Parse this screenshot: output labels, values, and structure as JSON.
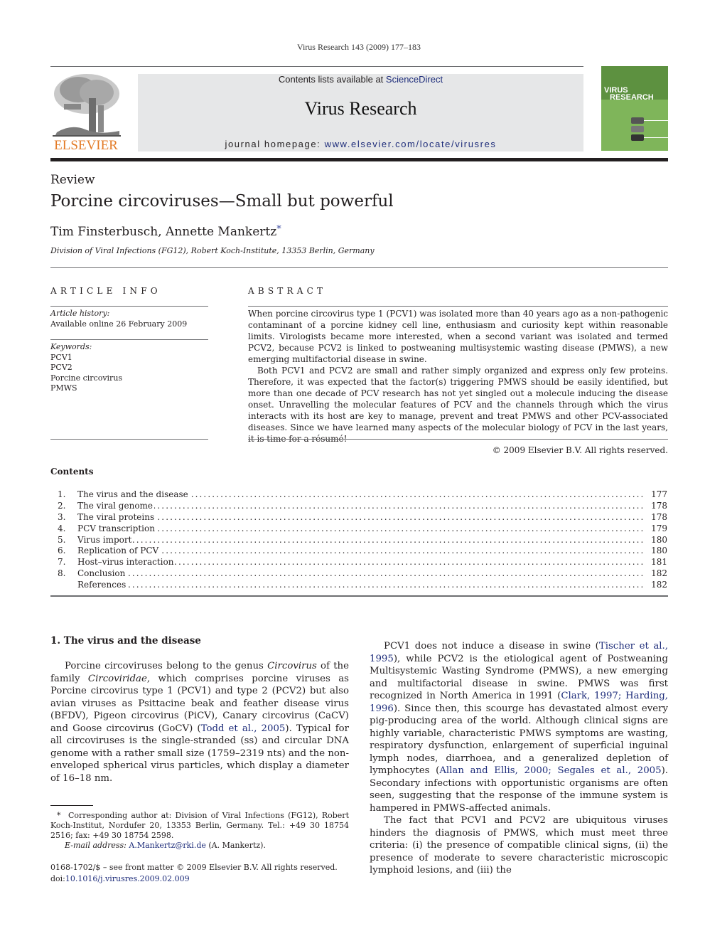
{
  "running_head": "Virus Research 143 (2009) 177–183",
  "masthead": {
    "contents_prefix": "Contents lists available at ",
    "contents_link": "ScienceDirect",
    "journal_title": "Virus Research",
    "homepage_prefix": "journal homepage: ",
    "homepage_link": "www.elsevier.com/locate/virusres",
    "publisher_logo_text": "ELSEVIER",
    "cover_title_line1": "VIRUS",
    "cover_title_line2": "RESEARCH",
    "colors": {
      "band": "#e6e7e8",
      "link": "#1d2c7a",
      "elsevier_orange": "#e37b27",
      "cover_green": "#7fb55a"
    }
  },
  "article": {
    "type": "Review",
    "title": "Porcine circoviruses—Small but powerful",
    "authors": "Tim Finsterbusch, Annette Mankertz",
    "corresponding_marker": "*",
    "affiliation": "Division of Viral Infections (FG12), Robert Koch-Institute, 13353 Berlin, Germany"
  },
  "article_info": {
    "heading": "ARTICLE INFO",
    "history_label": "Article history:",
    "history_value": "Available online 26 February 2009",
    "keywords_label": "Keywords:",
    "keywords": [
      "PCV1",
      "PCV2",
      "Porcine circovirus",
      "PMWS"
    ]
  },
  "abstract": {
    "heading": "ABSTRACT",
    "paragraphs": [
      "When porcine circovirus type 1 (PCV1) was isolated more than 40 years ago as a non-pathogenic contaminant of a porcine kidney cell line, enthusiasm and curiosity kept within reasonable limits. Virologists became more interested, when a second variant was isolated and termed PCV2, because PCV2 is linked to postweaning multisystemic wasting disease (PMWS), a new emerging multifactorial disease in swine.",
      "Both PCV1 and PCV2 are small and rather simply organized and express only few proteins. Therefore, it was expected that the factor(s) triggering PMWS should be easily identified, but more than one decade of PCV research has not yet singled out a molecule inducing the disease onset. Unravelling the molecular features of PCV and the channels through which the virus interacts with its host are key to manage, prevent and treat PMWS and other PCV-associated diseases. Since we have learned many aspects of the molecular biology of PCV in the last years, it is time for a résumé!"
    ],
    "copyright": "© 2009 Elsevier B.V. All rights reserved."
  },
  "contents": {
    "heading": "Contents",
    "items": [
      {
        "num": "1.",
        "label": "The virus and the disease",
        "page": "177"
      },
      {
        "num": "2.",
        "label": "The viral genome",
        "page": "178"
      },
      {
        "num": "3.",
        "label": "The viral proteins",
        "page": "178"
      },
      {
        "num": "4.",
        "label": "PCV transcription",
        "page": "179"
      },
      {
        "num": "5.",
        "label": "Virus import",
        "page": "180"
      },
      {
        "num": "6.",
        "label": "Replication of PCV",
        "page": "180"
      },
      {
        "num": "7.",
        "label": "Host–virus interaction",
        "page": "181"
      },
      {
        "num": "8.",
        "label": "Conclusion",
        "page": "182"
      },
      {
        "num": "",
        "label": "References",
        "page": "182"
      }
    ]
  },
  "section1": {
    "heading": "1.  The virus and the disease",
    "left_p1": {
      "t1": "Porcine circoviruses belong to the genus ",
      "i1": "Circovirus",
      "t2": " of the family ",
      "i2": "Circoviridae",
      "t3": ", which comprises porcine viruses as Porcine circovirus type 1 (PCV1) and type 2 (PCV2) but also avian viruses as Psittacine beak and feather disease virus (BFDV), Pigeon circovirus (PiCV), Canary circovirus (CaCV) and Goose circovirus (GoCV) (",
      "ref1": "Todd et al., 2005",
      "t4": "). Typical for all circoviruses is the single-stranded (ss) and circular DNA genome with a rather small size (1759–2319 nts) and the non-enveloped spherical virus particles, which display a diameter of 16–18 nm."
    },
    "right_p1": {
      "t1": "PCV1 does not induce a disease in swine (",
      "ref1": "Tischer et al., 1995",
      "t2": "), while PCV2 is the etiological agent of Postweaning Multisystemic Wasting Syndrome (PMWS), a new emerging and multifactorial disease in swine. PMWS was first recognized in North America in 1991 (",
      "ref2": "Clark, 1997; Harding, 1996",
      "t3": "). Since then, this scourge has devastated almost every pig-producing area of the world. Although clinical signs are highly variable, characteristic PMWS symptoms are wasting, respiratory dysfunction, enlargement of superficial inguinal lymph nodes, diarrhoea, and a generalized depletion of lymphocytes (",
      "ref3": "Allan and Ellis, 2000; Segales et al., 2005",
      "t4": "). Secondary infections with opportunistic organisms are often seen, suggesting that the response of the immune system is hampered in PMWS-affected animals."
    },
    "right_p2": "The fact that PCV1 and PCV2 are ubiquitous viruses hinders the diagnosis of PMWS, which must meet three criteria: (i) the presence of compatible clinical signs, (ii) the presence of moderate to severe characteristic microscopic lymphoid lesions, and (iii) the"
  },
  "footnote": {
    "marker": "*",
    "text": "Corresponding author at: Division of Viral Infections (FG12), Robert Koch-Institut, Nordufer 20, 13353 Berlin, Germany. Tel.: +49 30 18754 2516; fax: +49 30 18754 2598.",
    "email_label": "E-mail address:",
    "email": "A.Mankertz@rki.de",
    "email_suffix": " (A. Mankertz)."
  },
  "front_matter": {
    "issn_line": "0168-1702/$ – see front matter © 2009 Elsevier B.V. All rights reserved.",
    "doi_prefix": "doi:",
    "doi": "10.1016/j.virusres.2009.02.009"
  }
}
